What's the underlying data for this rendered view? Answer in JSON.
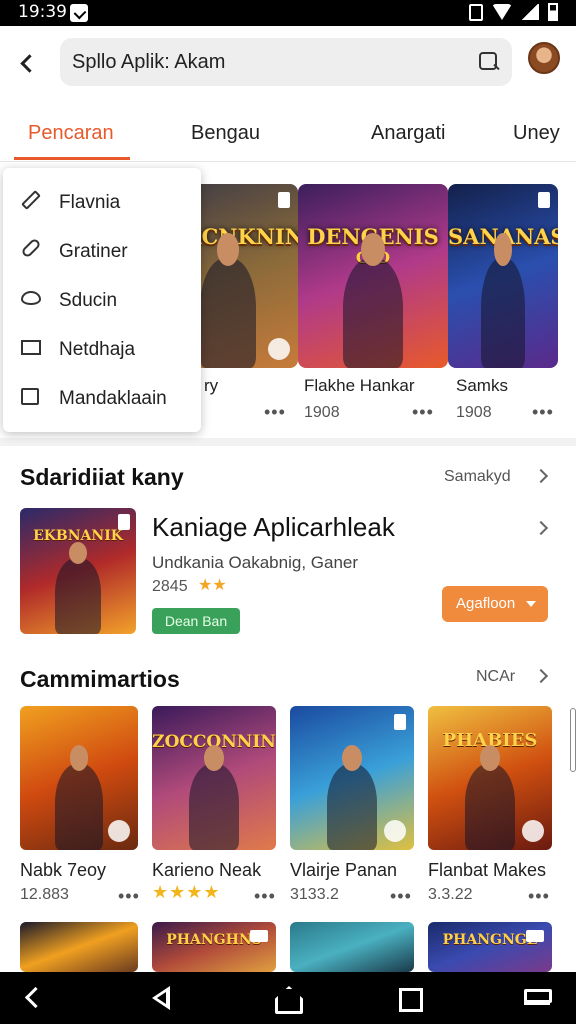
{
  "status": {
    "time": "19:39"
  },
  "search": {
    "value": "Spllo Aplik: Akam"
  },
  "tabs": [
    {
      "label": "Pencaran",
      "active": true
    },
    {
      "label": "Bengau"
    },
    {
      "label": "Anargati"
    },
    {
      "label": "Uney"
    }
  ],
  "menu": {
    "items": [
      {
        "label": "Flavnia",
        "icon": "pencil-icon"
      },
      {
        "label": "Gratiner",
        "icon": "link-icon"
      },
      {
        "label": "Sducin",
        "icon": "eye-icon"
      },
      {
        "label": "Netdhaja",
        "icon": "mail-icon"
      },
      {
        "label": "Mandaklaain",
        "icon": "box-icon"
      }
    ]
  },
  "top_games": [
    {
      "art_title": "RIACNKNIN",
      "art_sub": "",
      "name": "ry",
      "rating": "",
      "colors": [
        "#3d3a45",
        "#8a6a3a",
        "#c77b3a"
      ]
    },
    {
      "art_title": "DENGENIS",
      "art_sub": "CIO",
      "name": "Flakhe Hankar",
      "rating": "1908",
      "colors": [
        "#3b1f5c",
        "#b03a8a",
        "#e85a2a"
      ]
    },
    {
      "art_title": "SANANAS",
      "art_sub": "",
      "name": "Samks",
      "rating": "1908",
      "colors": [
        "#13204a",
        "#2a4fae",
        "#5a2a8a"
      ]
    }
  ],
  "featured_section": {
    "title": "Sdaridiiat kany",
    "more": "Samakyd",
    "app": {
      "name": "Kaniage Aplicarhleak",
      "developer": "Undkania Oakabnig, Ganer",
      "rating": "2845",
      "tag": "Dean Ban",
      "button_label": "Agafloon",
      "art_title": "EKBNANIK",
      "colors": [
        "#2a2a6a",
        "#b02a2a",
        "#f2a22a"
      ]
    }
  },
  "grid_section": {
    "title": "Cammimartios",
    "more": "NCAr",
    "games": [
      {
        "name": "Nabk 7eoy",
        "rating": "12.883",
        "stars": "",
        "art_title": "",
        "colors": [
          "#f0a020",
          "#d04a10",
          "#6a2a10"
        ]
      },
      {
        "name": "Karieno Neak",
        "rating": "",
        "stars": "★★★★",
        "art_title": "ZOCCONNIN",
        "colors": [
          "#3a1a5a",
          "#b04a7a",
          "#e07a4a"
        ]
      },
      {
        "name": "Vlairje Panan",
        "rating": "3133.2",
        "stars": "",
        "art_title": "",
        "colors": [
          "#1a4aa0",
          "#3aa0d8",
          "#e0c040"
        ]
      },
      {
        "name": "Flanbat Makes",
        "rating": "3.3.22",
        "stars": "",
        "art_title": "PHABIES",
        "colors": [
          "#f0c040",
          "#d05010",
          "#6a1a10"
        ]
      }
    ],
    "bottom_row": [
      {
        "art_title": "",
        "colors": [
          "#1a1a2a",
          "#f0a020",
          "#6a3a20"
        ]
      },
      {
        "art_title": "PHANGHNS",
        "colors": [
          "#3a1a4a",
          "#b04a3a",
          "#e0a040"
        ]
      },
      {
        "art_title": "",
        "colors": [
          "#2a7a8a",
          "#4ab0c0",
          "#1a3a4a"
        ]
      },
      {
        "art_title": "PHANGNGE",
        "colors": [
          "#1a2a6a",
          "#3a4ab0",
          "#7a3a8a"
        ]
      }
    ]
  }
}
